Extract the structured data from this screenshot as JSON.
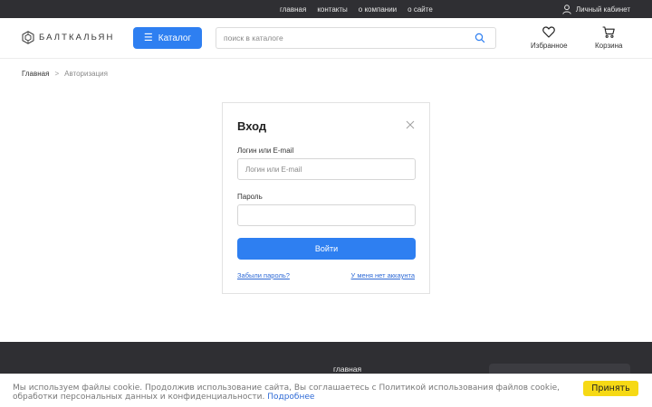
{
  "topbar": {
    "links": [
      "главная",
      "контакты",
      "о компании",
      "о сайте"
    ],
    "account_label": "Личный кабинет"
  },
  "header": {
    "logo_text": "БАЛТКАЛЬЯН",
    "catalog_label": "Каталог",
    "search_placeholder": "поиск в каталоге",
    "favorites_label": "Избранное",
    "cart_label": "Корзина"
  },
  "breadcrumb": {
    "home": "Главная",
    "separator": ">",
    "current": "Авторизация"
  },
  "login": {
    "title": "Вход",
    "login_label": "Логин или E-mail",
    "login_placeholder": "Логин или E-mail",
    "login_value": "",
    "password_label": "Пароль",
    "password_value": "",
    "submit_label": "Войти",
    "forgot_label": "Забыли пароль?",
    "register_label": "У меня нет аккаунта"
  },
  "footer": {
    "link": "главная"
  },
  "cookie": {
    "text": "Мы используем файлы cookie. Продолжив использование сайта, Вы соглашаетесь с Политикой использования файлов cookie, обработки персональных данных и конфиденциальности.",
    "more_label": "Подробнее",
    "accept_label": "Принять"
  },
  "colors": {
    "accent": "#2e7ff1",
    "dark_bar": "#2f2f33",
    "cookie_button": "#f6d915",
    "link": "#2e6ad6"
  },
  "icons": [
    "user-icon",
    "logo-icon",
    "burger-icon",
    "search-icon",
    "heart-icon",
    "cart-icon",
    "close-icon"
  ]
}
